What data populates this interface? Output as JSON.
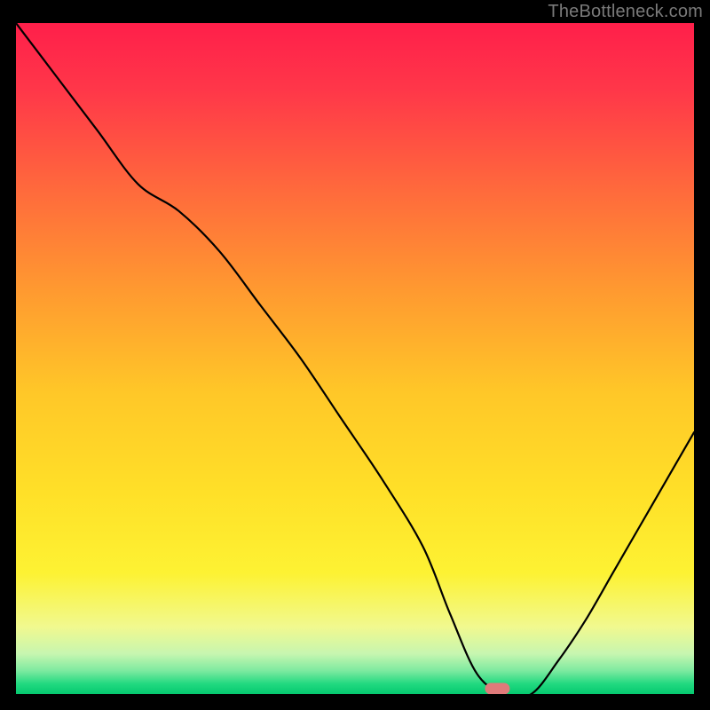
{
  "watermark": "TheBottleneck.com",
  "chart_data": {
    "type": "line",
    "title": "",
    "xlabel": "",
    "ylabel": "",
    "xlim": [
      0,
      100
    ],
    "ylim": [
      0,
      100
    ],
    "background": {
      "type": "vertical-gradient",
      "stops": [
        {
          "offset": 0.0,
          "color": "#ff1f4a"
        },
        {
          "offset": 0.1,
          "color": "#ff3749"
        },
        {
          "offset": 0.25,
          "color": "#ff6a3c"
        },
        {
          "offset": 0.4,
          "color": "#ff9a30"
        },
        {
          "offset": 0.55,
          "color": "#ffc728"
        },
        {
          "offset": 0.7,
          "color": "#ffe028"
        },
        {
          "offset": 0.82,
          "color": "#fdf233"
        },
        {
          "offset": 0.9,
          "color": "#f1f98f"
        },
        {
          "offset": 0.94,
          "color": "#c7f6b0"
        },
        {
          "offset": 0.965,
          "color": "#7eeaa0"
        },
        {
          "offset": 0.985,
          "color": "#21d980"
        },
        {
          "offset": 1.0,
          "color": "#05c96f"
        }
      ]
    },
    "series": [
      {
        "name": "bottleneck-curve",
        "color": "#000000",
        "x": [
          0,
          6,
          12,
          18,
          24,
          30,
          36,
          42,
          48,
          54,
          60,
          64,
          68,
          72,
          76,
          80,
          84,
          88,
          92,
          96,
          100
        ],
        "y": [
          100,
          92,
          84,
          76,
          72,
          66,
          58,
          50,
          41,
          32,
          22,
          12,
          3,
          0,
          0,
          5,
          11,
          18,
          25,
          32,
          39
        ]
      }
    ],
    "marker": {
      "name": "optimal-point",
      "x": 71,
      "y": 0.8,
      "color": "#e07a7a",
      "shape": "pill"
    }
  }
}
